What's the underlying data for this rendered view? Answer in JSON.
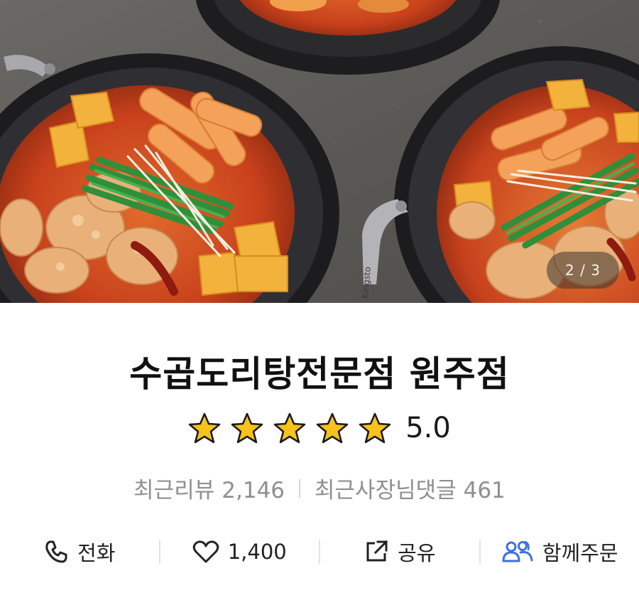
{
  "gallery": {
    "current_page": "2",
    "total_pages": "3",
    "indicator_text": "2 / 3",
    "pan_brand_text": "Kingsto"
  },
  "store": {
    "name": "수곱도리탕전문점 원주점",
    "rating_value": "5.0",
    "rating_stars": 5,
    "star_color": "#f6c21b"
  },
  "stats": {
    "recent_reviews_label": "최근리뷰",
    "recent_reviews_count": "2,146",
    "owner_replies_label": "최근사장님댓글",
    "owner_replies_count": "461"
  },
  "actions": {
    "call_label": "전화",
    "like_count": "1,400",
    "share_label": "공유",
    "group_order_label": "함께주문"
  },
  "icons": {
    "call": "phone-icon",
    "like": "heart-icon",
    "share": "share-icon",
    "group_order": "people-icon",
    "star": "star-icon"
  },
  "colors": {
    "group_order_icon": "#3f6fe0",
    "title_text": "#111111",
    "muted_text": "#8f8f8f"
  }
}
